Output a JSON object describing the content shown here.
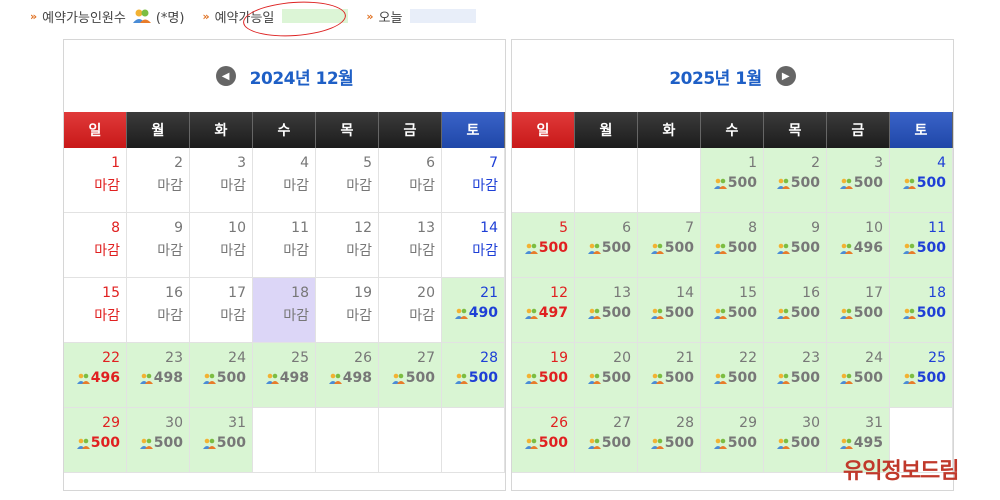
{
  "legend": {
    "people_label": "예약가능인원수",
    "people_suffix": "(*명)",
    "available_label": "예약가능일",
    "today_label": "오늘",
    "arrow": "»"
  },
  "colors": {
    "available": "#dcf5d6",
    "today": "#dcd6f7",
    "sunday": "#e02020",
    "saturday": "#1e3fd6",
    "title": "#1e5fc6"
  },
  "weekdays": [
    "일",
    "월",
    "화",
    "수",
    "목",
    "금",
    "토"
  ],
  "watermark": "유익정보드림",
  "calendars": [
    {
      "title": "2024년 12월",
      "nav": "prev",
      "weeks": [
        [
          {
            "d": "1",
            "s": "마감"
          },
          {
            "d": "2",
            "s": "마감"
          },
          {
            "d": "3",
            "s": "마감"
          },
          {
            "d": "4",
            "s": "마감"
          },
          {
            "d": "5",
            "s": "마감"
          },
          {
            "d": "6",
            "s": "마감"
          },
          {
            "d": "7",
            "s": "마감"
          }
        ],
        [
          {
            "d": "8",
            "s": "마감"
          },
          {
            "d": "9",
            "s": "마감"
          },
          {
            "d": "10",
            "s": "마감"
          },
          {
            "d": "11",
            "s": "마감"
          },
          {
            "d": "12",
            "s": "마감"
          },
          {
            "d": "13",
            "s": "마감"
          },
          {
            "d": "14",
            "s": "마감"
          }
        ],
        [
          {
            "d": "15",
            "s": "마감"
          },
          {
            "d": "16",
            "s": "마감"
          },
          {
            "d": "17",
            "s": "마감"
          },
          {
            "d": "18",
            "s": "마감",
            "today": true
          },
          {
            "d": "19",
            "s": "마감"
          },
          {
            "d": "20",
            "s": "마감"
          },
          {
            "d": "21",
            "c": "490"
          }
        ],
        [
          {
            "d": "22",
            "c": "496"
          },
          {
            "d": "23",
            "c": "498"
          },
          {
            "d": "24",
            "c": "500"
          },
          {
            "d": "25",
            "c": "498"
          },
          {
            "d": "26",
            "c": "498"
          },
          {
            "d": "27",
            "c": "500"
          },
          {
            "d": "28",
            "c": "500"
          }
        ],
        [
          {
            "d": "29",
            "c": "500"
          },
          {
            "d": "30",
            "c": "500"
          },
          {
            "d": "31",
            "c": "500"
          },
          {},
          {},
          {},
          {}
        ]
      ]
    },
    {
      "title": "2025년 1월",
      "nav": "next",
      "weeks": [
        [
          {},
          {},
          {},
          {
            "d": "1",
            "c": "500"
          },
          {
            "d": "2",
            "c": "500"
          },
          {
            "d": "3",
            "c": "500"
          },
          {
            "d": "4",
            "c": "500"
          }
        ],
        [
          {
            "d": "5",
            "c": "500"
          },
          {
            "d": "6",
            "c": "500"
          },
          {
            "d": "7",
            "c": "500"
          },
          {
            "d": "8",
            "c": "500"
          },
          {
            "d": "9",
            "c": "500"
          },
          {
            "d": "10",
            "c": "496"
          },
          {
            "d": "11",
            "c": "500"
          }
        ],
        [
          {
            "d": "12",
            "c": "497"
          },
          {
            "d": "13",
            "c": "500"
          },
          {
            "d": "14",
            "c": "500"
          },
          {
            "d": "15",
            "c": "500"
          },
          {
            "d": "16",
            "c": "500"
          },
          {
            "d": "17",
            "c": "500"
          },
          {
            "d": "18",
            "c": "500"
          }
        ],
        [
          {
            "d": "19",
            "c": "500"
          },
          {
            "d": "20",
            "c": "500"
          },
          {
            "d": "21",
            "c": "500"
          },
          {
            "d": "22",
            "c": "500"
          },
          {
            "d": "23",
            "c": "500"
          },
          {
            "d": "24",
            "c": "500"
          },
          {
            "d": "25",
            "c": "500"
          }
        ],
        [
          {
            "d": "26",
            "c": "500"
          },
          {
            "d": "27",
            "c": "500"
          },
          {
            "d": "28",
            "c": "500"
          },
          {
            "d": "29",
            "c": "500"
          },
          {
            "d": "30",
            "c": "500"
          },
          {
            "d": "31",
            "c": "495"
          },
          {}
        ]
      ]
    }
  ]
}
